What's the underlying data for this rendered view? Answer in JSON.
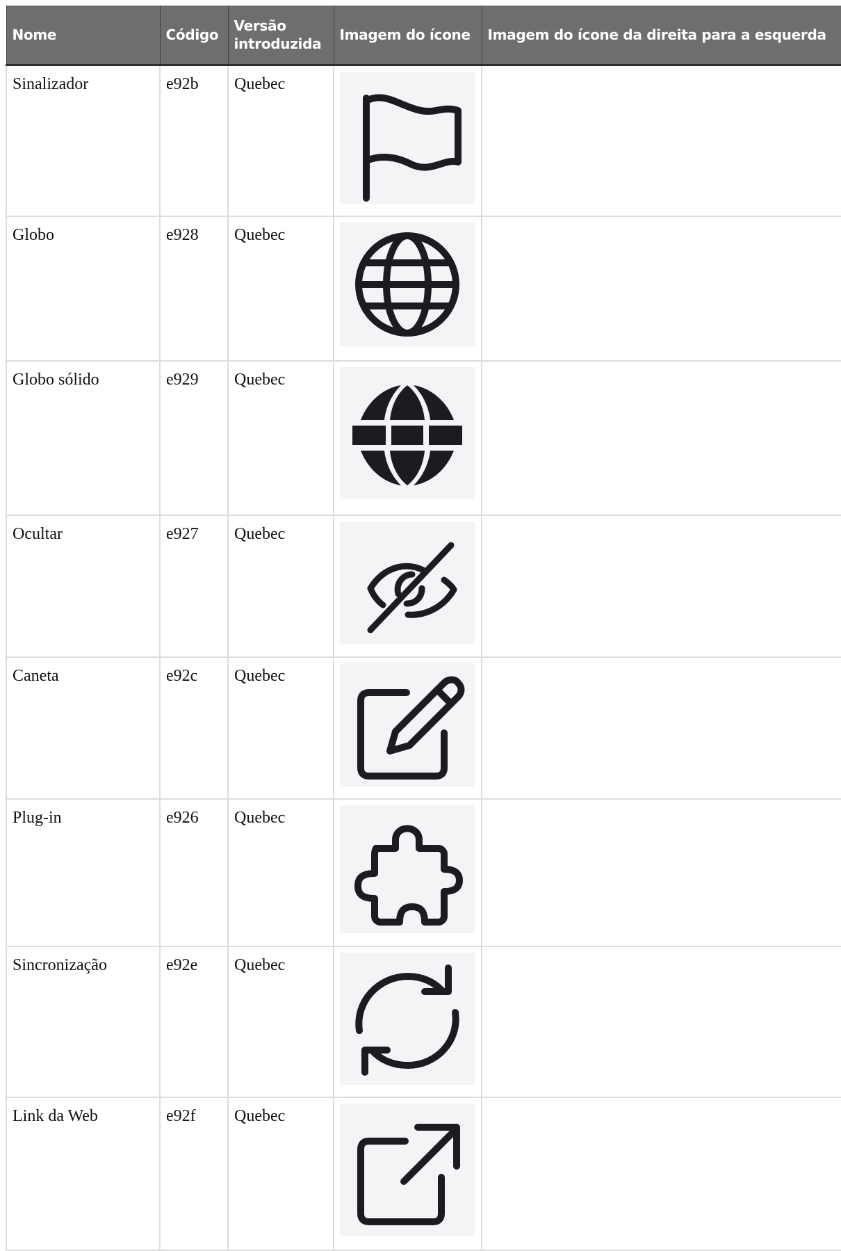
{
  "table": {
    "headers": {
      "name": "Nome",
      "code": "Código",
      "version": "Versão introduzida",
      "image": "Imagem do ícone",
      "image_rtl": "Imagem do ícone da direita para a esquerda"
    },
    "rows": [
      {
        "name": "Sinalizador",
        "code": "e92b",
        "version": "Quebec",
        "icon": "flag-icon",
        "rtl": ""
      },
      {
        "name": "Globo",
        "code": "e928",
        "version": "Quebec",
        "icon": "globe-icon",
        "rtl": ""
      },
      {
        "name": "Globo sólido",
        "code": "e929",
        "version": "Quebec",
        "icon": "globe-solid-icon",
        "rtl": ""
      },
      {
        "name": "Ocultar",
        "code": "e927",
        "version": "Quebec",
        "icon": "eye-slash-icon",
        "rtl": ""
      },
      {
        "name": "Caneta",
        "code": "e92c",
        "version": "Quebec",
        "icon": "pen-icon",
        "rtl": ""
      },
      {
        "name": "Plug-in",
        "code": "e926",
        "version": "Quebec",
        "icon": "puzzle-icon",
        "rtl": ""
      },
      {
        "name": "Sincronização",
        "code": "e92e",
        "version": "Quebec",
        "icon": "sync-icon",
        "rtl": ""
      },
      {
        "name": "Link da Web",
        "code": "e92f",
        "version": "Quebec",
        "icon": "external-link-icon",
        "rtl": ""
      }
    ]
  },
  "colors": {
    "header_bg": "#6e6e6e",
    "header_text": "#ffffff",
    "icon_bg": "#f3f4f6",
    "icon_fg": "#1a1c22",
    "border": "#dcdcdc"
  }
}
